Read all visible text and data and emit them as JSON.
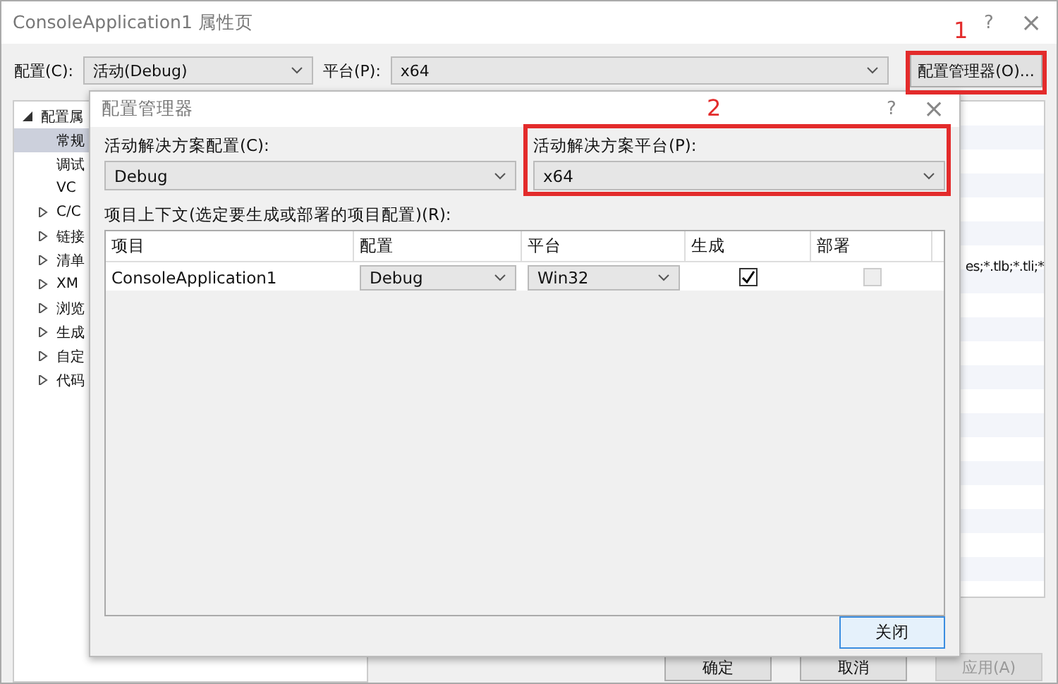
{
  "window": {
    "title": "ConsoleApplication1 属性页",
    "help": "?",
    "close": "×"
  },
  "toolbar": {
    "config_label": "配置(C):",
    "config_value": "活动(Debug)",
    "platform_label": "平台(P):",
    "platform_value": "x64",
    "manager_button": "配置管理器(O)..."
  },
  "tree": [
    {
      "label": "配置属",
      "expanded": true,
      "selected": false,
      "children": [
        {
          "label": "常规",
          "selected": true
        },
        {
          "label": "调试",
          "selected": false
        },
        {
          "label": "VC",
          "selected": false
        },
        {
          "label": "C/C",
          "expanded": false,
          "selected": false
        },
        {
          "label": "链接",
          "expanded": false,
          "selected": false
        },
        {
          "label": "清单",
          "expanded": false,
          "selected": false
        },
        {
          "label": "XM",
          "expanded": false,
          "selected": false
        },
        {
          "label": "浏览",
          "expanded": false,
          "selected": false
        },
        {
          "label": "生成",
          "expanded": false,
          "selected": false
        },
        {
          "label": "自定",
          "expanded": false,
          "selected": false
        },
        {
          "label": "代码",
          "expanded": false,
          "selected": false
        }
      ]
    }
  ],
  "property_text": "es;*.tlb;*.tli;*",
  "buttons": [
    {
      "label": "确定",
      "disabled": false
    },
    {
      "label": "取消",
      "disabled": false
    },
    {
      "label": "应用(A)",
      "disabled": true
    }
  ],
  "dialog": {
    "title": "配置管理器",
    "help": "?",
    "close": "×",
    "solution_config_label": "活动解决方案配置(C):",
    "solution_config_value": "Debug",
    "solution_platform_label": "活动解决方案平台(P):",
    "solution_platform_value": "x64",
    "context_label": "项目上下文(选定要生成或部署的项目配置)(R):",
    "columns": [
      "项目",
      "配置",
      "平台",
      "生成",
      "部署"
    ],
    "rows": [
      {
        "project": "ConsoleApplication1",
        "config": "Debug",
        "platform": "Win32",
        "build": {
          "checked": true,
          "disabled": false
        },
        "deploy": {
          "checked": false,
          "disabled": true
        }
      }
    ],
    "close_button": "关闭"
  },
  "annotations": [
    {
      "label": "1"
    },
    {
      "label": "2"
    }
  ]
}
